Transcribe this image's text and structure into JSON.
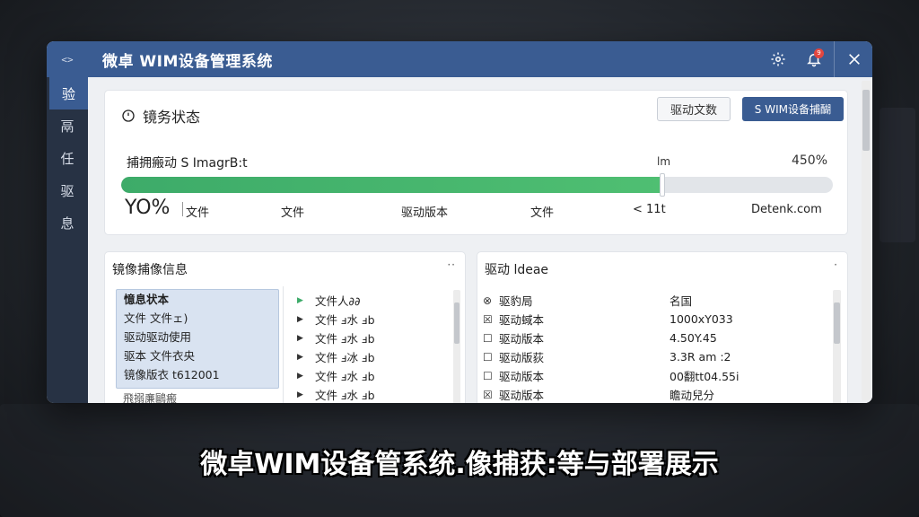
{
  "window": {
    "code_icon_text": "<>",
    "title": "微卓 WIM设备管理系统",
    "notification_count": "9"
  },
  "sidebar": {
    "items": [
      {
        "label": "验",
        "active": true
      },
      {
        "label": "鬲"
      },
      {
        "label": "任"
      },
      {
        "label": "驱"
      },
      {
        "label": "息"
      }
    ]
  },
  "status": {
    "title": "镜务状态",
    "btn_doc": "驱动文数",
    "btn_primary": "S WIM设备捕醐",
    "progress_label": "捕拥瘢动 S ImagrB:t",
    "progress_unit": "lm",
    "progress_pct_text": "450%",
    "progress_fraction": 0.76,
    "big_pct": "YO%",
    "stats": [
      "文件",
      "文件",
      "驱动版本",
      "文件",
      "< 11t",
      "Detenk.com"
    ]
  },
  "image_panel": {
    "title": "镜像捕像信息",
    "more": "··",
    "list": [
      "憶息状本",
      "文件 文件ェ)",
      "驱动驱动使用",
      "驱本 文件衣央",
      "镜像版衣 t612001"
    ],
    "list_tail": "飛搦亷鷗瘢",
    "tree": [
      {
        "label": "文件人∂∂",
        "green": true
      },
      {
        "label": "文件 ⅎ水  ⅎb"
      },
      {
        "label": "文件 ⅎ水  ⅎb"
      },
      {
        "label": "文件 ⅎ冰  ⅎb"
      },
      {
        "label": "文件 ⅎ水  ⅎb"
      },
      {
        "label": "文件 ⅎ水  ⅎb"
      }
    ]
  },
  "driver_panel": {
    "title": "驱动 ldeae",
    "more": "·",
    "rows": [
      {
        "icon": "⊗",
        "name": "驱豹局",
        "value": "名国"
      },
      {
        "icon": "☒",
        "name": "驱动蜮本",
        "value": "1000xY033"
      },
      {
        "icon": "☐",
        "name": "驱动版本",
        "value": "4.50Y.45"
      },
      {
        "icon": "☐",
        "name": "驱动版荻",
        "value": "3.3R am :2"
      },
      {
        "icon": "☐",
        "name": "驱动版本",
        "value": "00翻tt04.55i"
      },
      {
        "icon": "☒",
        "name": "驱动版本",
        "value": "瞻动兒分"
      }
    ]
  },
  "caption": "微卓WIM设备管系统.像捕获:等与部署展示"
}
